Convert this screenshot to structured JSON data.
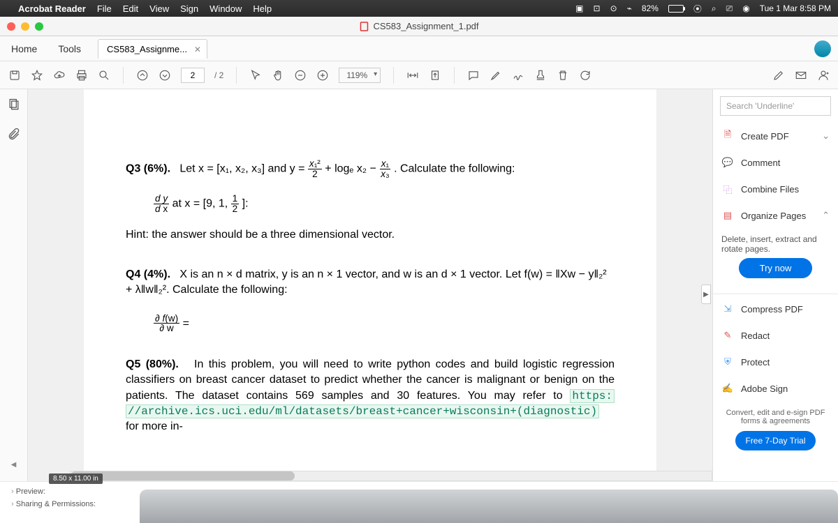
{
  "menubar": {
    "app": "Acrobat Reader",
    "items": [
      "File",
      "Edit",
      "View",
      "Sign",
      "Window",
      "Help"
    ],
    "battery": "82%",
    "clock": "Tue 1 Mar 8:58 PM"
  },
  "window": {
    "title": "CS583_Assignment_1.pdf"
  },
  "tabs": {
    "home": "Home",
    "tools": "Tools",
    "doc": "CS583_Assignme..."
  },
  "toolbar": {
    "page_current": "2",
    "page_total": "/ 2",
    "zoom": "119%"
  },
  "rightpanel": {
    "search_placeholder": "Search 'Underline'",
    "create_pdf": "Create PDF",
    "comment": "Comment",
    "combine": "Combine Files",
    "organize": "Organize Pages",
    "organize_desc": "Delete, insert, extract and rotate pages.",
    "try_now": "Try now",
    "compress": "Compress PDF",
    "redact": "Redact",
    "protect": "Protect",
    "adobe_sign": "Adobe Sign",
    "sign_desc": "Convert, edit and e-sign PDF forms & agreements",
    "free_trial": "Free 7-Day Trial"
  },
  "document": {
    "q3_head": "Q3 (6%).",
    "q3_body_a": "Let x = [x₁, x₂, x₃] and y = ",
    "q3_body_b": " + logₑ x₂ − ",
    "q3_body_c": ". Calculate the following:",
    "q3_deriv_a": " at x = [9, 1, ",
    "q3_deriv_b": "]:",
    "q3_hint": "Hint: the answer should be a three dimensional vector.",
    "q4_head": "Q4 (4%).",
    "q4_body": "X is an n × d matrix, y is an n × 1 vector, and w is an d × 1 vector. Let f(w) = ‖Xw − y‖₂² + λ‖w‖₂². Calculate the following:",
    "q4_deriv": " = ",
    "q5_head": "Q5 (80%).",
    "q5_body_a": "In this problem, you will need to write python codes and build logistic regression classifiers on breast cancer dataset to predict whether the cancer is malignant or benign on the patients. The dataset contains 569 samples and 30 features. You may refer to ",
    "q5_url1": "https:",
    "q5_url2": "//archive.ics.uci.edu/ml/datasets/breast+cancer+wisconsin+(diagnostic)",
    "q5_body_b": " for more in-"
  },
  "bottom": {
    "dims": "8.50 x 11.00 in",
    "preview": "Preview:",
    "sharing": "Sharing & Permissions:"
  }
}
